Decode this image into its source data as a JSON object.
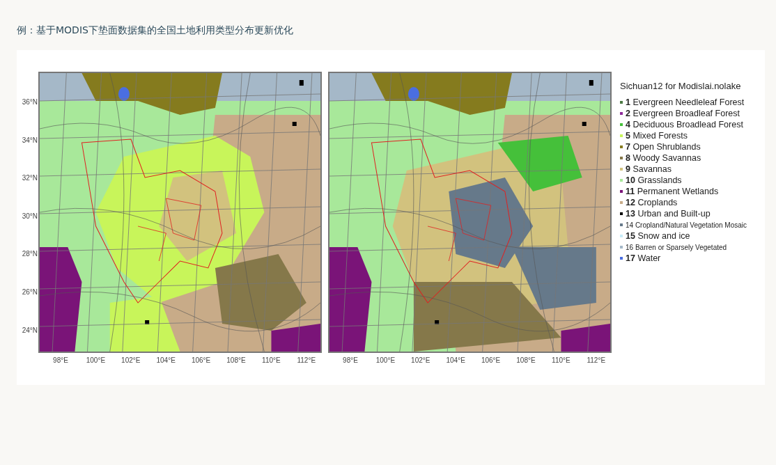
{
  "title": "例：基于MODIS下垫面数据集的全国土地利用类型分布更新优化",
  "maps": [
    {
      "y_ticks": [
        "36°N",
        "34°N",
        "32°N",
        "30°N",
        "28°N",
        "26°N",
        "24°N"
      ],
      "x_ticks": [
        "98°E",
        "100°E",
        "102°E",
        "104°E",
        "106°E",
        "108°E",
        "110°E",
        "112°E"
      ]
    },
    {
      "x_ticks": [
        "98°E",
        "100°E",
        "102°E",
        "104°E",
        "106°E",
        "108°E",
        "110°E",
        "112°E"
      ]
    }
  ],
  "legend": {
    "title": "Sichuan12 for Modislai.nolake",
    "items": [
      {
        "label": "**1** Evergreen Needleleaf Forest",
        "color": "#4d7a45",
        "kind": "normal"
      },
      {
        "label": "**2** Evergreen Broadleaf Forest",
        "color": "#8e2a9a",
        "kind": "normal"
      },
      {
        "label": "**4** Deciduous Broadlead Forest",
        "color": "#45c03a",
        "kind": "normal"
      },
      {
        "label": "**5** Mixed Forests",
        "color": "#c8f55a",
        "kind": "normal"
      },
      {
        "label": "**7** Open Shrublands",
        "color": "#857b1e",
        "kind": "normal"
      },
      {
        "label": "**8** Woody Savannas",
        "color": "#85784a",
        "kind": "normal"
      },
      {
        "label": "**9** Savannas",
        "color": "#d2c27e",
        "kind": "normal"
      },
      {
        "label": "**10** Grasslands",
        "color": "#a8e89a",
        "kind": "normal"
      },
      {
        "label": "**11** Permanent Wetlands",
        "color": "#7a1478",
        "kind": "normal"
      },
      {
        "label": "**12** Croplands",
        "color": "#c8ab88",
        "kind": "normal"
      },
      {
        "label": "**13** Urban and Built-up",
        "color": "#000000",
        "kind": "normal"
      },
      {
        "label": "14 Cropland/Natural Vegetation Mosaic",
        "color": "#66798a",
        "kind": "small"
      },
      {
        "label": "**15** Snow and ice",
        "color": "#c8ecf8",
        "kind": "normal"
      },
      {
        "label": "16 Barren or Sparsely Vegetated",
        "color": "#a5b8c8",
        "kind": "small"
      },
      {
        "label": "**17** Water",
        "color": "#4a6ee0",
        "kind": "normal"
      }
    ]
  }
}
